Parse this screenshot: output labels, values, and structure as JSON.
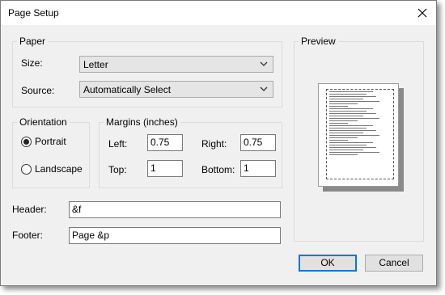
{
  "window": {
    "title": "Page Setup",
    "close_icon": "close-icon"
  },
  "paper": {
    "legend": "Paper",
    "size_label": "Size:",
    "size_value": "Letter",
    "source_label": "Source:",
    "source_value": "Automatically Select"
  },
  "preview": {
    "legend": "Preview"
  },
  "orientation": {
    "legend": "Orientation",
    "portrait_label": "Portrait",
    "landscape_label": "Landscape",
    "selected": "Portrait"
  },
  "margins": {
    "legend": "Margins (inches)",
    "left_label": "Left:",
    "left_value": "0.75",
    "right_label": "Right:",
    "right_value": "0.75",
    "top_label": "Top:",
    "top_value": "1",
    "bottom_label": "Bottom:",
    "bottom_value": "1"
  },
  "header": {
    "label": "Header:",
    "value": "&f"
  },
  "footer": {
    "label": "Footer:",
    "value": "Page &p"
  },
  "buttons": {
    "ok": "OK",
    "cancel": "Cancel"
  }
}
